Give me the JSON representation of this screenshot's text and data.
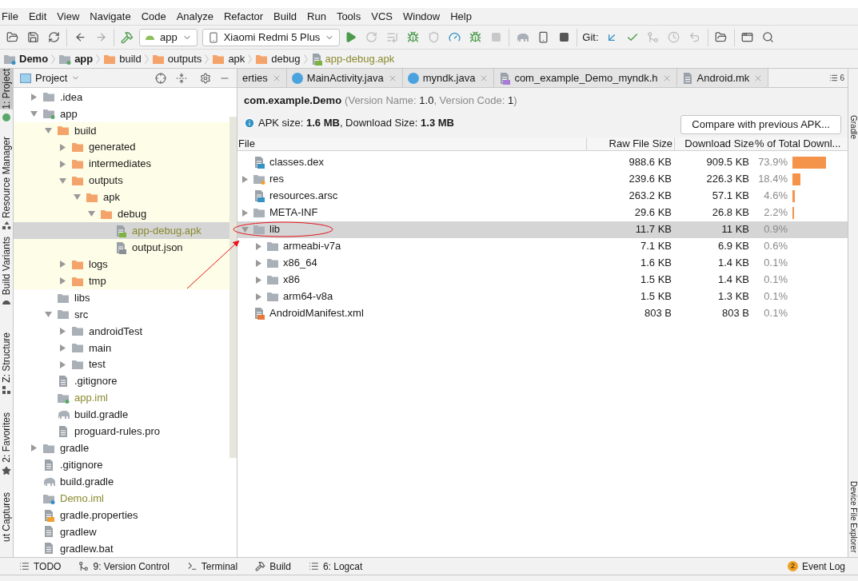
{
  "menu": [
    "File",
    "Edit",
    "View",
    "Navigate",
    "Code",
    "Analyze",
    "Refactor",
    "Build",
    "Run",
    "Tools",
    "VCS",
    "Window",
    "Help"
  ],
  "toolbar": {
    "config": "app",
    "device": "Xiaomi Redmi 5 Plus",
    "git_label": "Git:"
  },
  "breadcrumbs": [
    {
      "label": "Demo",
      "kind": "project"
    },
    {
      "label": "app",
      "kind": "module"
    },
    {
      "label": "build",
      "kind": "build-folder"
    },
    {
      "label": "outputs",
      "kind": "build-folder"
    },
    {
      "label": "apk",
      "kind": "build-folder"
    },
    {
      "label": "debug",
      "kind": "build-folder"
    },
    {
      "label": "app-debug.apk",
      "kind": "apk"
    }
  ],
  "left_strip": [
    {
      "label": "1: Project",
      "selected": true
    },
    {
      "label": "Resource Manager",
      "selected": false
    },
    {
      "label": "Build Variants",
      "selected": false
    },
    {
      "label": "Z: Structure",
      "selected": false
    },
    {
      "label": "2: Favorites",
      "selected": false
    },
    {
      "label": "ut Captures",
      "selected": false
    }
  ],
  "project_panel": {
    "title": "Project",
    "tree": [
      {
        "label": ".idea",
        "kind": "folder",
        "expanded": false
      },
      {
        "label": "app",
        "kind": "module",
        "expanded": true,
        "children": [
          {
            "label": "build",
            "kind": "build-folder",
            "expanded": true,
            "generated": true,
            "children": [
              {
                "label": "generated",
                "kind": "build-folder",
                "expanded": false,
                "generated": true
              },
              {
                "label": "intermediates",
                "kind": "build-folder",
                "expanded": false,
                "generated": true
              },
              {
                "label": "outputs",
                "kind": "build-folder",
                "expanded": true,
                "generated": true,
                "children": [
                  {
                    "label": "apk",
                    "kind": "build-folder",
                    "expanded": true,
                    "generated": true,
                    "children": [
                      {
                        "label": "debug",
                        "kind": "build-folder",
                        "expanded": true,
                        "generated": true,
                        "children": [
                          {
                            "label": "app-debug.apk",
                            "kind": "apk",
                            "generated": true,
                            "selected": true
                          },
                          {
                            "label": "output.json",
                            "kind": "json",
                            "generated": true,
                            "selected": false
                          }
                        ]
                      }
                    ]
                  }
                ]
              },
              {
                "label": "logs",
                "kind": "build-folder",
                "expanded": false,
                "generated": true
              },
              {
                "label": "tmp",
                "kind": "build-folder",
                "expanded": false,
                "generated": true
              }
            ]
          },
          {
            "label": "libs",
            "kind": "folder"
          },
          {
            "label": "src",
            "kind": "folder",
            "expanded": true,
            "children": [
              {
                "label": "androidTest",
                "kind": "folder",
                "expanded": false
              },
              {
                "label": "main",
                "kind": "folder",
                "expanded": false
              },
              {
                "label": "test",
                "kind": "folder",
                "expanded": false
              }
            ]
          },
          {
            "label": ".gitignore",
            "kind": "file"
          },
          {
            "label": "app.iml",
            "kind": "module-file"
          },
          {
            "label": "build.gradle",
            "kind": "gradle"
          },
          {
            "label": "proguard-rules.pro",
            "kind": "file"
          }
        ]
      },
      {
        "label": "gradle",
        "kind": "folder",
        "expanded": false
      },
      {
        "label": ".gitignore",
        "kind": "file"
      },
      {
        "label": "build.gradle",
        "kind": "gradle"
      },
      {
        "label": "Demo.iml",
        "kind": "project-file"
      },
      {
        "label": "gradle.properties",
        "kind": "properties"
      },
      {
        "label": "gradlew",
        "kind": "file"
      },
      {
        "label": "gradlew.bat",
        "kind": "file"
      }
    ]
  },
  "editor_tabs": [
    {
      "label": "erties",
      "kind": "cut"
    },
    {
      "label": "MainActivity.java",
      "kind": "class"
    },
    {
      "label": "myndk.java",
      "kind": "class"
    },
    {
      "label": "com_example_Demo_myndk.h",
      "kind": "header"
    },
    {
      "label": "Android.mk",
      "kind": "text"
    }
  ],
  "tab_count": "6",
  "apk": {
    "package": "com.example.Demo",
    "version": "(Version Name: **1.0**, Version Code: **1**)",
    "size": "APK size: **1.6 MB**, Download Size: **1.3 MB**",
    "compare_button": "Compare with previous APK...",
    "columns": [
      "File",
      "Raw File Size",
      "Download Size",
      "% of Total Downl..."
    ],
    "rows": [
      {
        "name": "classes.dex",
        "kind": "dex",
        "raw": "988.6 KB",
        "download": "909.5 KB",
        "percent": "73.9%",
        "selected": false
      },
      {
        "name": "res",
        "kind": "res",
        "expanded": false,
        "raw": "239.6 KB",
        "download": "226.3 KB",
        "percent": "18.4%",
        "selected": false
      },
      {
        "name": "resources.arsc",
        "kind": "arsc",
        "raw": "263.2 KB",
        "download": "57.1 KB",
        "percent": "4.6%",
        "selected": false
      },
      {
        "name": "META-INF",
        "kind": "folder",
        "expanded": false,
        "raw": "29.6 KB",
        "download": "26.8 KB",
        "percent": "2.2%",
        "selected": false
      },
      {
        "name": "lib",
        "kind": "folder",
        "expanded": true,
        "raw": "11.7 KB",
        "download": "11 KB",
        "percent": "0.9%",
        "selected": true,
        "children": [
          {
            "name": "armeabi-v7a",
            "kind": "folder",
            "expanded": false,
            "raw": "7.1 KB",
            "download": "6.9 KB",
            "percent": "0.6%",
            "selected": false
          },
          {
            "name": "x86_64",
            "kind": "folder",
            "expanded": false,
            "raw": "1.6 KB",
            "download": "1.4 KB",
            "percent": "0.1%",
            "selected": false
          },
          {
            "name": "x86",
            "kind": "folder",
            "expanded": false,
            "raw": "1.5 KB",
            "download": "1.4 KB",
            "percent": "0.1%",
            "selected": false
          },
          {
            "name": "arm64-v8a",
            "kind": "folder",
            "expanded": false,
            "raw": "1.5 KB",
            "download": "1.3 KB",
            "percent": "0.1%",
            "selected": false
          }
        ]
      },
      {
        "name": "AndroidManifest.xml",
        "kind": "xml",
        "raw": "803 B",
        "download": "803 B",
        "percent": "0.1%",
        "selected": false
      }
    ]
  },
  "right_strip": [
    "Gradle",
    "Device File Explorer"
  ],
  "bottom_tools": [
    {
      "label": "TODO",
      "kind": "list"
    },
    {
      "label": "9: Version Control",
      "kind": "vcs"
    },
    {
      "label": "Terminal",
      "kind": "terminal"
    },
    {
      "label": "Build",
      "kind": "hammer"
    },
    {
      "label": "6: Logcat",
      "kind": "list"
    }
  ],
  "event_log": {
    "badge": "2",
    "label": "Event Log"
  }
}
